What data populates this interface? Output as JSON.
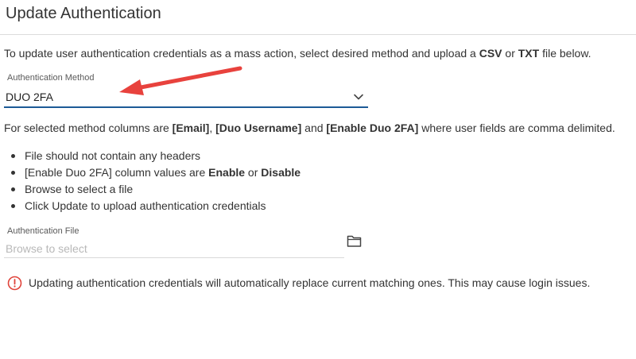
{
  "header": {
    "title": "Update Authentication"
  },
  "intro": {
    "text_before": "To update user authentication credentials as a mass action, select desired method and upload a ",
    "csv": "CSV",
    "or": " or ",
    "txt": "TXT",
    "text_after": " file below."
  },
  "method_field": {
    "label": "Authentication Method",
    "value": "DUO 2FA"
  },
  "columns": {
    "prefix": "For selected method columns are ",
    "col1": "[Email]",
    "sep1": ", ",
    "col2": "[Duo Username]",
    "sep2": " and ",
    "col3": "[Enable Duo 2FA]",
    "suffix": " where user fields are comma delimited."
  },
  "instructions": {
    "item1": "File should not contain any headers",
    "item2_prefix": "[Enable Duo 2FA] column values are ",
    "item2_enable": "Enable",
    "item2_or": " or ",
    "item2_disable": "Disable",
    "item3": "Browse to select a file",
    "item4": "Click Update to upload authentication credentials"
  },
  "file_field": {
    "label": "Authentication File",
    "placeholder": "Browse to select"
  },
  "warning": {
    "text": "Updating authentication credentials will automatically replace current matching ones. This may cause login issues."
  },
  "icons": {
    "chevron": "chevron-down-icon",
    "folder": "folder-icon",
    "warning": "alert-circle-icon",
    "annotation": "red-arrow-annotation"
  },
  "colors": {
    "accent": "#1c5a96",
    "warning": "#e0433a",
    "annotation_arrow": "#e8423d"
  }
}
